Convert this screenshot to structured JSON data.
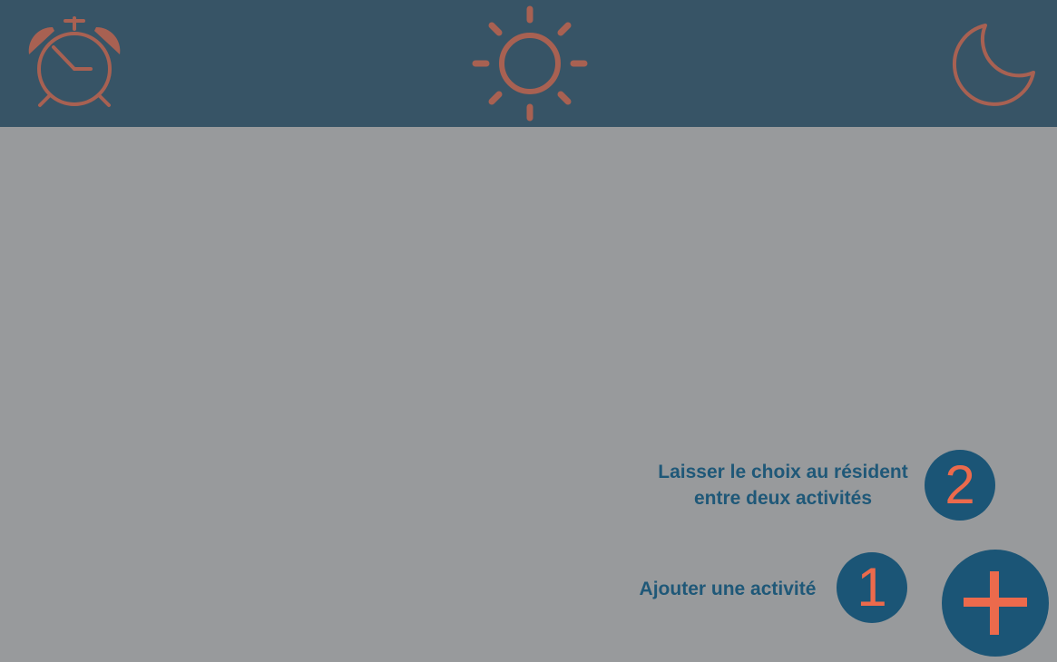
{
  "header": {
    "morning_icon": "alarm-clock-icon",
    "day_icon": "sun-icon",
    "evening_icon": "moon-icon",
    "icon_color": "#a86152",
    "background_color": "#375466"
  },
  "main": {
    "background_color": "#989a9c",
    "choice_label_line1": "Laisser le choix au résident",
    "choice_label_line2": "entre deux activités",
    "choice_step": "2",
    "add_label": "Ajouter une activité",
    "add_step": "1",
    "add_icon": "plus-icon",
    "accent_color": "#1b5576",
    "number_color": "#ec6a4c"
  }
}
